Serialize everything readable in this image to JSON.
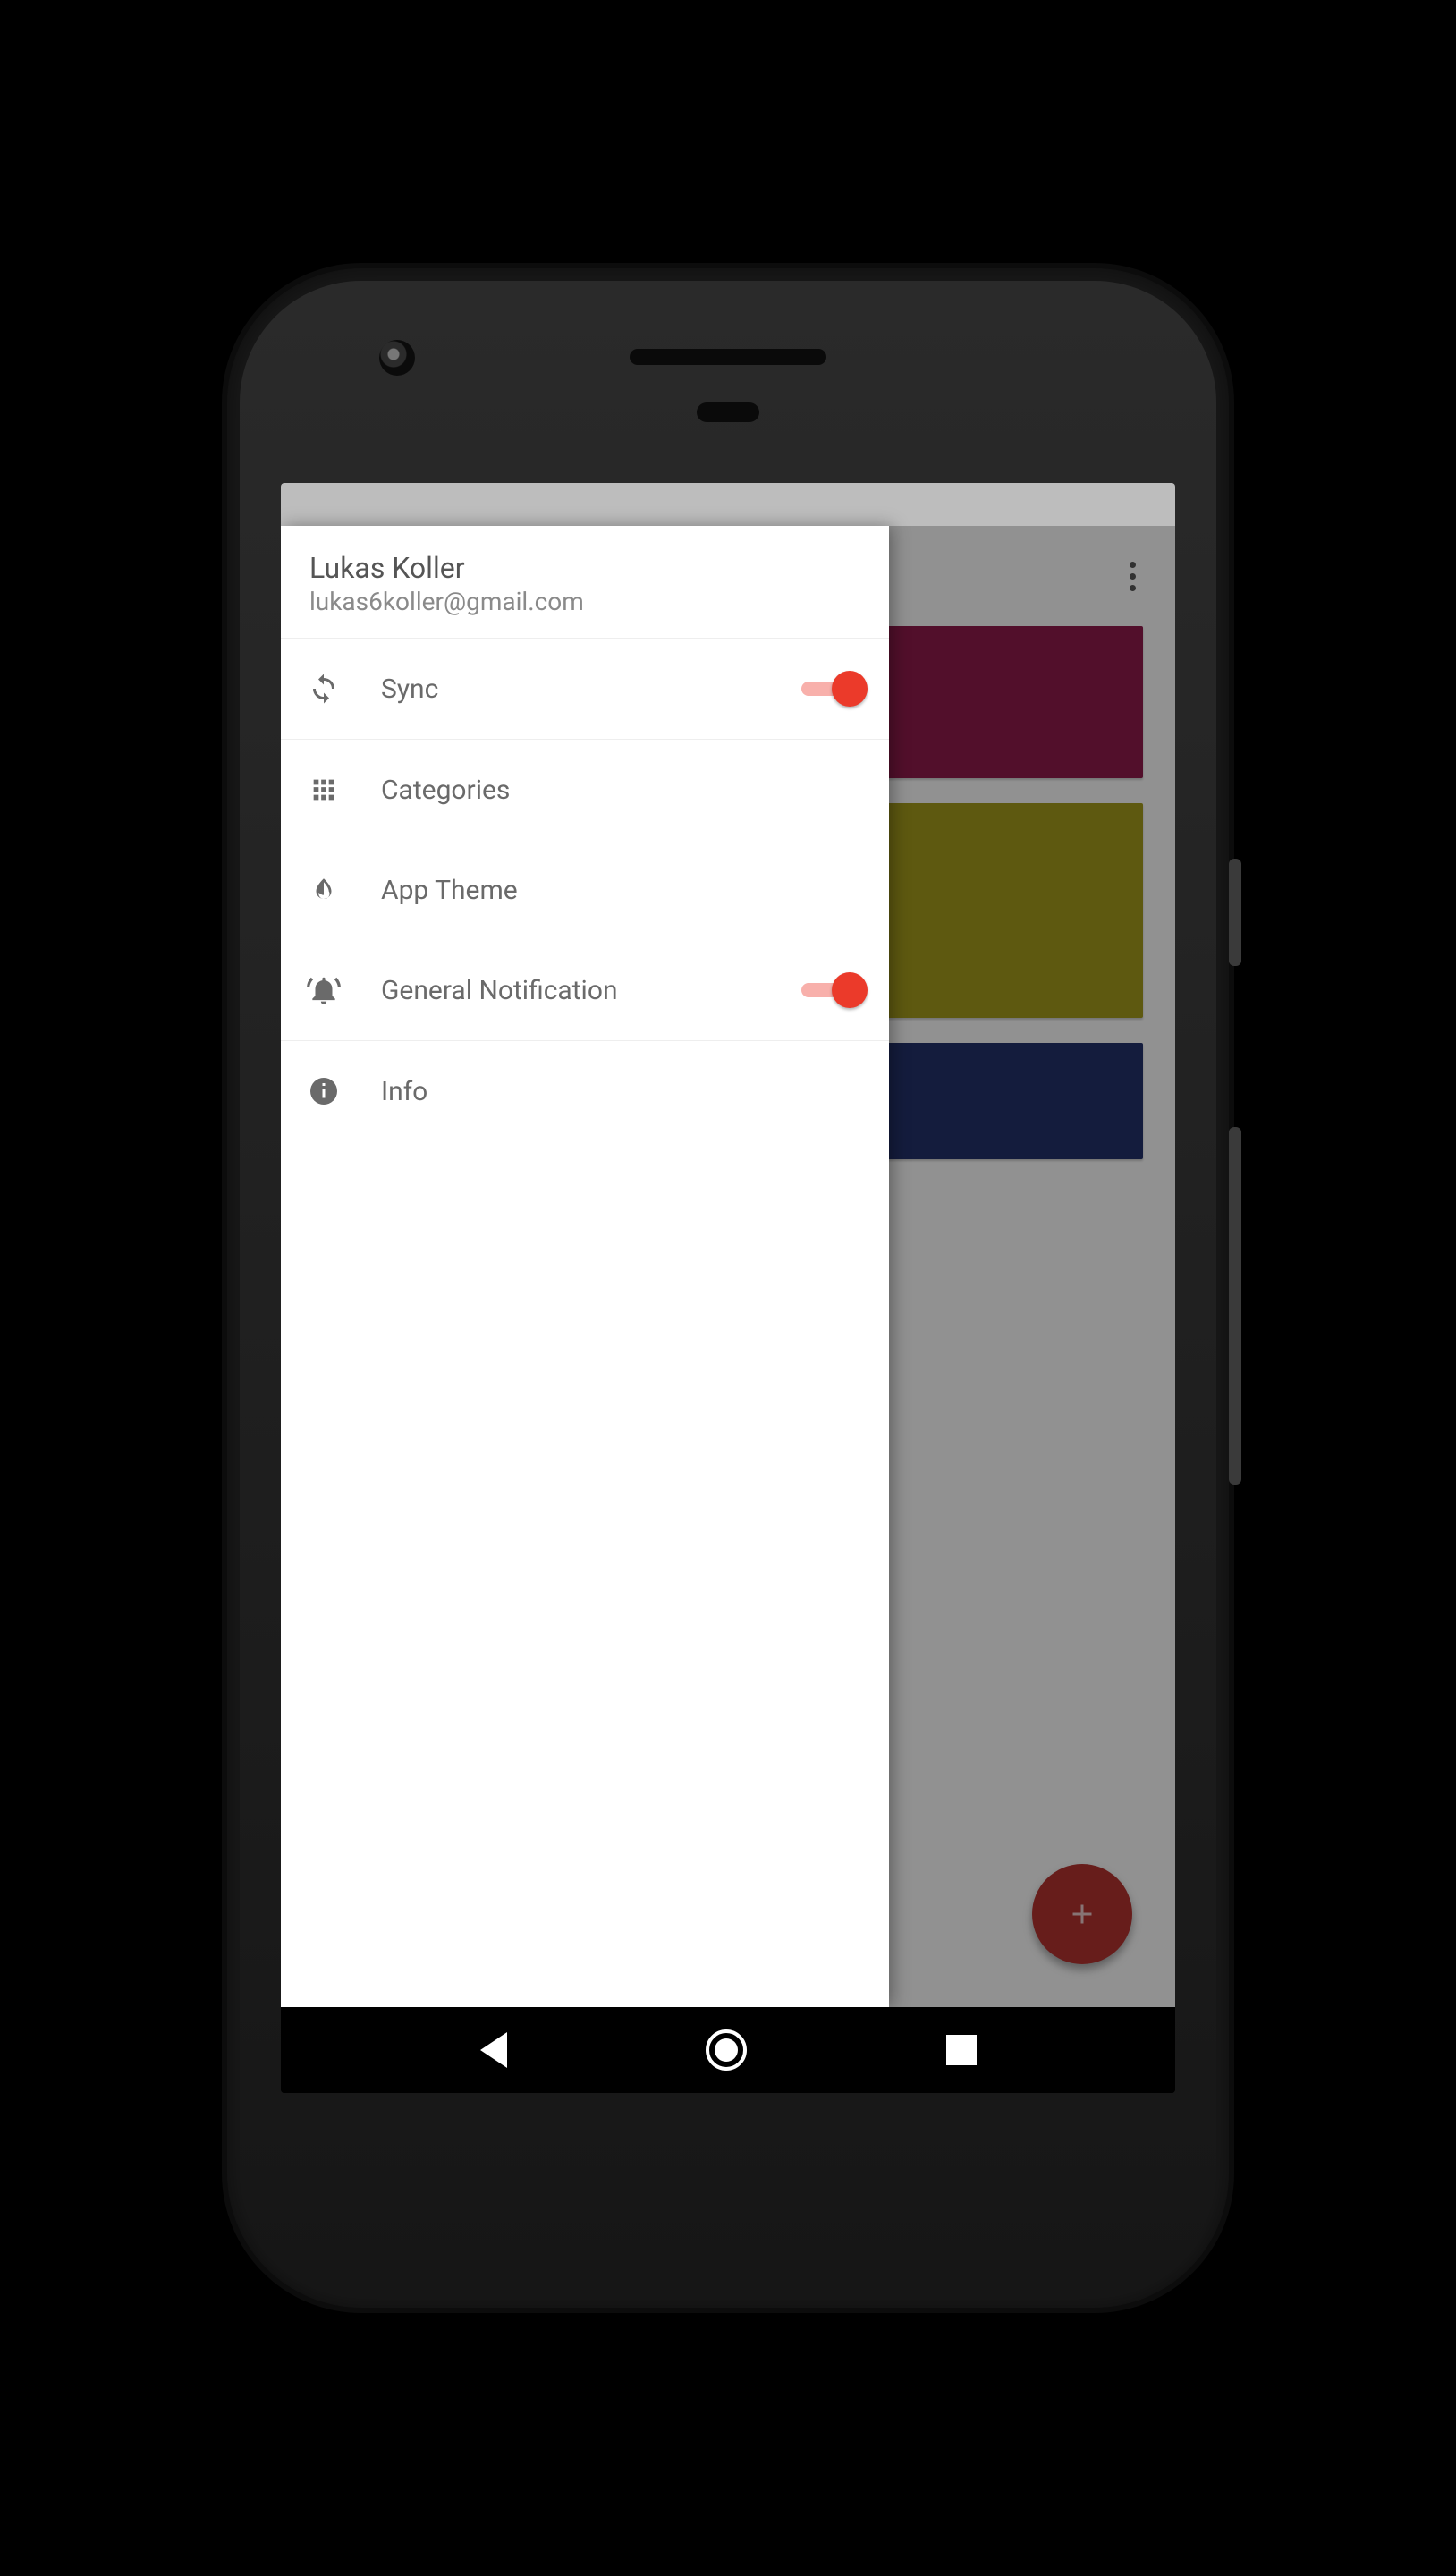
{
  "user": {
    "name": "Lukas Koller",
    "email": "lukas6koller@gmail.com"
  },
  "drawer": {
    "sync": {
      "label": "Sync",
      "on": true
    },
    "categories_label": "Categories",
    "theme_label": "App Theme",
    "notifications": {
      "label": "General Notification",
      "on": true
    },
    "info_label": "Info"
  },
  "colors": {
    "accent": "#eb3a2a",
    "card1": "#8e1a4a",
    "card2": "#a39a1c",
    "card3": "#24316a",
    "fab": "#b23230"
  },
  "icons": {
    "sync": "sync-icon",
    "categories": "grid-icon",
    "theme": "contrast-icon",
    "notifications": "bell-alert-icon",
    "info": "info-icon",
    "overflow": "more-vert-icon",
    "fab": "plus-icon"
  }
}
